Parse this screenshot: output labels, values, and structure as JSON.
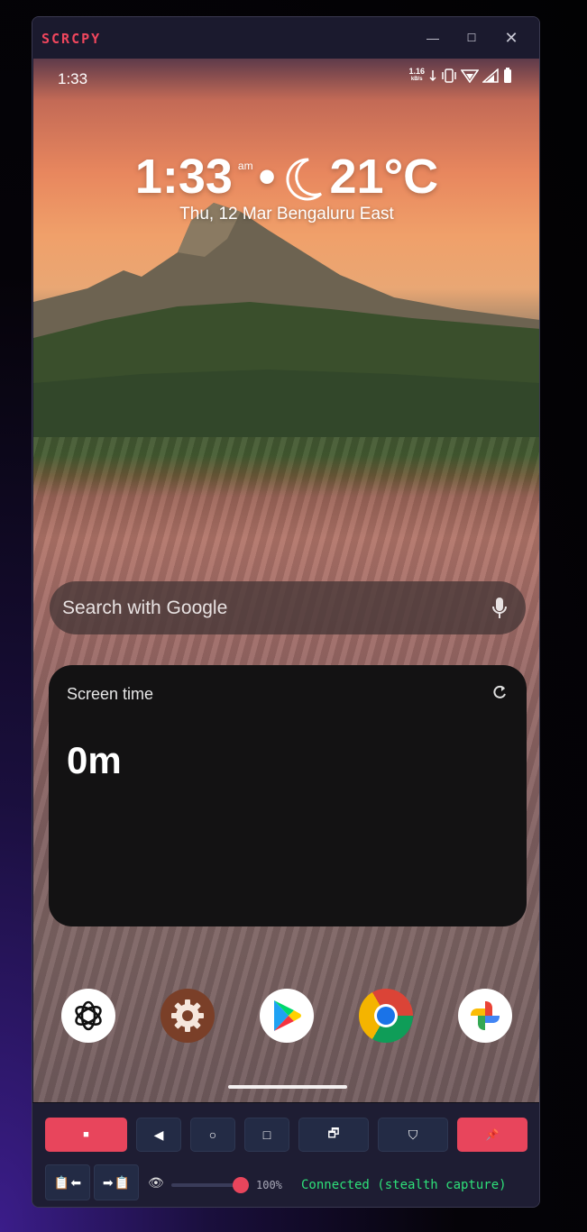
{
  "window": {
    "title": "SCRCPY",
    "minimize_icon": "—",
    "maximize_icon": "☐",
    "close_icon": "✕"
  },
  "phone": {
    "status_bar": {
      "time": "1:33",
      "net_speed": "1.16",
      "net_unit": "kB/s"
    },
    "clock": {
      "time": "1:33",
      "ampm": "am",
      "separator": "•",
      "temperature": "21°C",
      "date": "Thu, 12 Mar",
      "location": "Bengaluru East"
    },
    "search": {
      "placeholder": "Search with Google"
    },
    "widget": {
      "title": "Screen time",
      "value": "0m"
    },
    "dock": [
      "ChatGPT",
      "Settings",
      "Play Store",
      "Chrome",
      "Photos"
    ]
  },
  "toolbar": {
    "buttons": [
      {
        "name": "stop",
        "glyph": "■"
      },
      {
        "name": "back",
        "glyph": "◀"
      },
      {
        "name": "home",
        "glyph": "○"
      },
      {
        "name": "recents",
        "glyph": "□"
      },
      {
        "name": "screenshot",
        "glyph": "🗗"
      },
      {
        "name": "shield",
        "glyph": "⛉"
      },
      {
        "name": "pin",
        "glyph": "📌"
      }
    ],
    "clip_pull": {
      "left": "📋",
      "arrow": "⬅"
    },
    "clip_push": {
      "arrow": "➡",
      "right": "📋"
    },
    "eye_glyph": "👁",
    "opacity_percent": 100,
    "opacity_label": "100%",
    "status": "Connected (stealth capture)"
  },
  "colors": {
    "accent": "#e8455c",
    "status_ok": "#2ee079",
    "title": "#f0465d"
  }
}
